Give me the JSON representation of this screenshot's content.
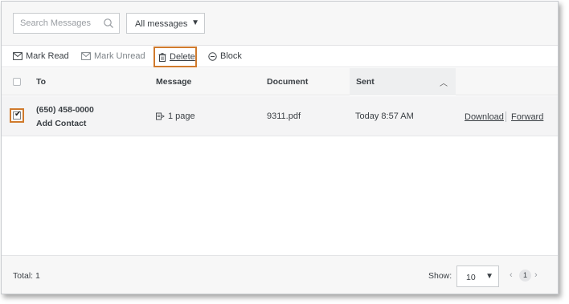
{
  "filter": {
    "search_placeholder": "Search Messages",
    "filter_value": "All messages"
  },
  "actions": {
    "mark_read": "Mark Read",
    "mark_unread": "Mark Unread",
    "delete": "Delete",
    "block": "Block"
  },
  "table": {
    "headers": {
      "to": "To",
      "message": "Message",
      "document": "Document",
      "sent": "Sent"
    },
    "rows": [
      {
        "checked": true,
        "phone": "(650) 458-0000",
        "contact_action": "Add Contact",
        "message": "1 page",
        "document": "9311.pdf",
        "sent": "Today 8:57 AM",
        "download": "Download",
        "forward": "Forward"
      }
    ]
  },
  "footer": {
    "total": "Total: 1",
    "show_label": "Show:",
    "page_size": "10",
    "current_page": "1"
  },
  "colors": {
    "highlight": "#d07a2c",
    "header_bg": "#f7f7f7",
    "row_bg": "#f4f4f5"
  }
}
